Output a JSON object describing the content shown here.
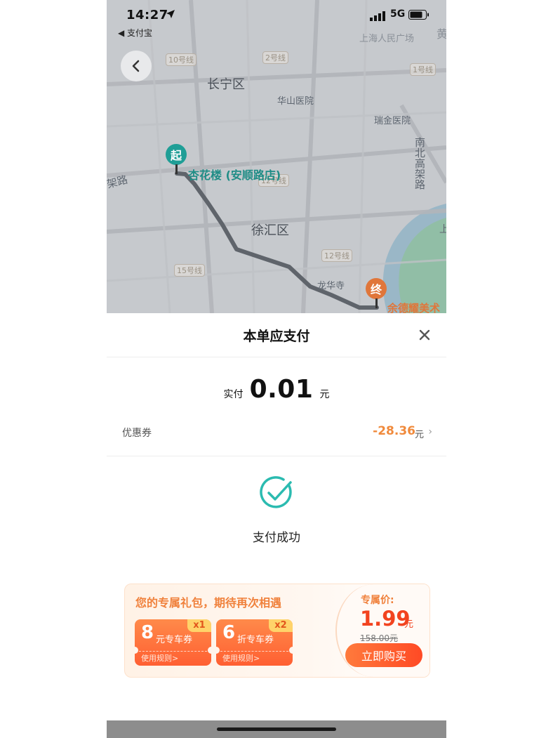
{
  "status_bar": {
    "time": "14:27",
    "back_app": "◀ 支付宝",
    "network": "5G"
  },
  "map": {
    "districts": [
      "长宁区",
      "徐汇区"
    ],
    "places": {
      "huashan": "华山医院",
      "ruijin": "瑞金医院",
      "longhua": "龙华寺",
      "peoples_square": "上海人民广场",
      "huang": "黄",
      "south_north": "南北高架路",
      "west_road": "架路",
      "shang": "上"
    },
    "metro_tags": [
      "10号线",
      "2号线",
      "1号线",
      "12号线",
      "12号线",
      "15号线",
      "7号线"
    ],
    "start": {
      "marker": "起",
      "name": "杏花楼 (安顺路店)"
    },
    "end": {
      "marker": "终",
      "name": "余德耀美术"
    }
  },
  "sheet": {
    "title": "本单应支付",
    "paid_label": "实付",
    "paid_amount": "0.01",
    "paid_unit": "元",
    "coupon_label": "优惠券",
    "coupon_value": "-28.36",
    "coupon_unit": "元",
    "success_text": "支付成功"
  },
  "promo": {
    "title": "您的专属礼包，期待再次相遇",
    "vouchers": [
      {
        "big": "8",
        "small": "元专车券",
        "count": "x1",
        "rule": "使用规则>"
      },
      {
        "big": "6",
        "small": "折专车券",
        "count": "x2",
        "rule": "使用规则>"
      }
    ],
    "exclusive_label": "专属价:",
    "price": "1.99",
    "price_unit": "元",
    "original_price": "158.00元",
    "buy_label": "立即购买"
  },
  "colors": {
    "brand_teal": "#1f9e96",
    "accent_orange": "#f08a3c",
    "price_red": "#f2431f"
  },
  "icons": [
    "location-arrow-icon",
    "signal-icon",
    "battery-icon",
    "back-chevron-icon",
    "close-icon",
    "chevron-right-icon",
    "success-check-icon"
  ]
}
